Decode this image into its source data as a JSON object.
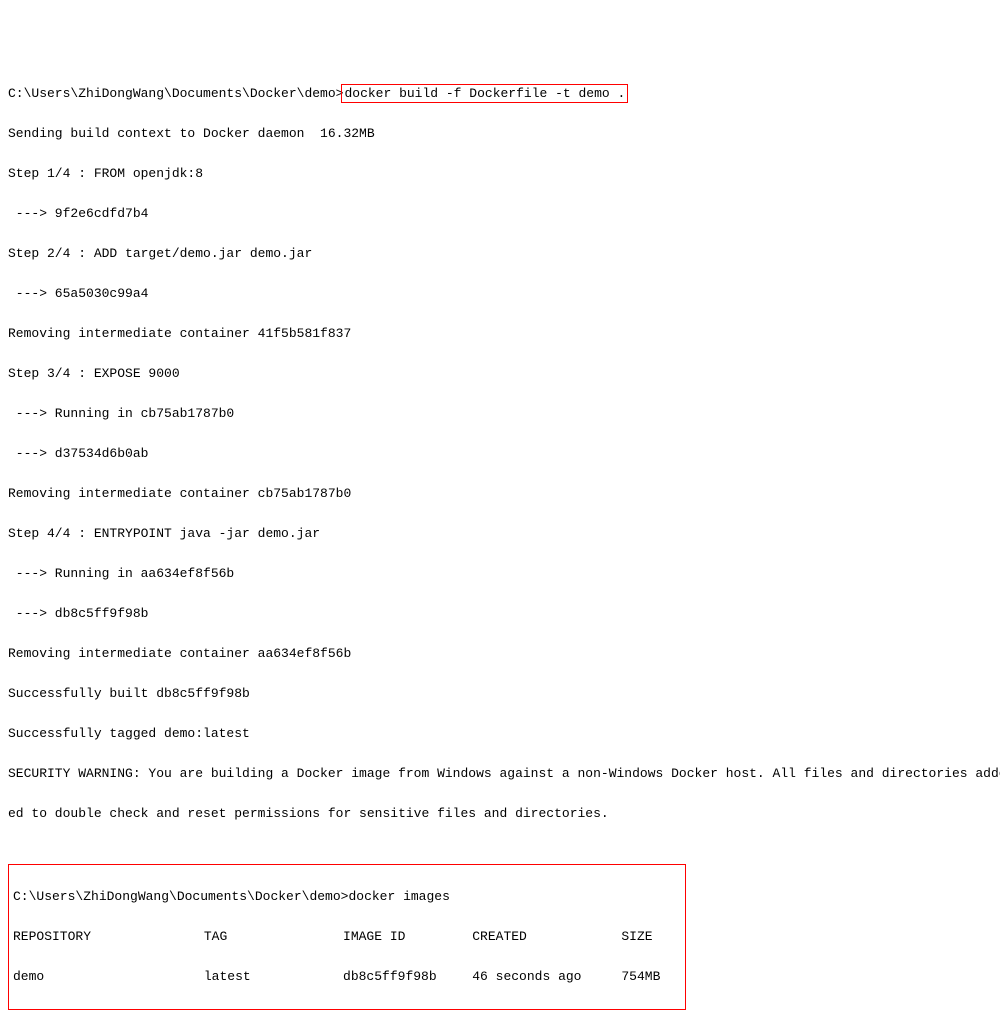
{
  "prompt1_path": "C:\\Users\\ZhiDongWang\\Documents\\Docker\\demo>",
  "prompt1_cmd": "docker build -f Dockerfile -t demo .",
  "lines": [
    "Sending build context to Docker daemon  16.32MB",
    "Step 1/4 : FROM openjdk:8",
    " ---> 9f2e6cdfd7b4",
    "Step 2/4 : ADD target/demo.jar demo.jar",
    " ---> 65a5030c99a4",
    "Removing intermediate container 41f5b581f837",
    "Step 3/4 : EXPOSE 9000",
    " ---> Running in cb75ab1787b0",
    " ---> d37534d6b0ab",
    "Removing intermediate container cb75ab1787b0",
    "Step 4/4 : ENTRYPOINT java -jar demo.jar",
    " ---> Running in aa634ef8f56b",
    " ---> db8c5ff9f98b",
    "Removing intermediate container aa634ef8f56b",
    "Successfully built db8c5ff9f98b",
    "Successfully tagged demo:latest",
    "SECURITY WARNING: You are building a Docker image from Windows against a non-Windows Docker host. All files and directories added to build cont",
    "ed to double check and reset permissions for sensitive files and directories.",
    ""
  ],
  "prompt2_path": "C:\\Users\\ZhiDongWang\\Documents\\Docker\\demo>",
  "prompt2_cmd": "docker images",
  "table": {
    "headers": [
      "REPOSITORY",
      "TAG",
      "IMAGE ID",
      "CREATED",
      "SIZE"
    ],
    "row": [
      "demo",
      "latest",
      "db8c5ff9f98b",
      "46 seconds ago",
      "754MB"
    ]
  }
}
